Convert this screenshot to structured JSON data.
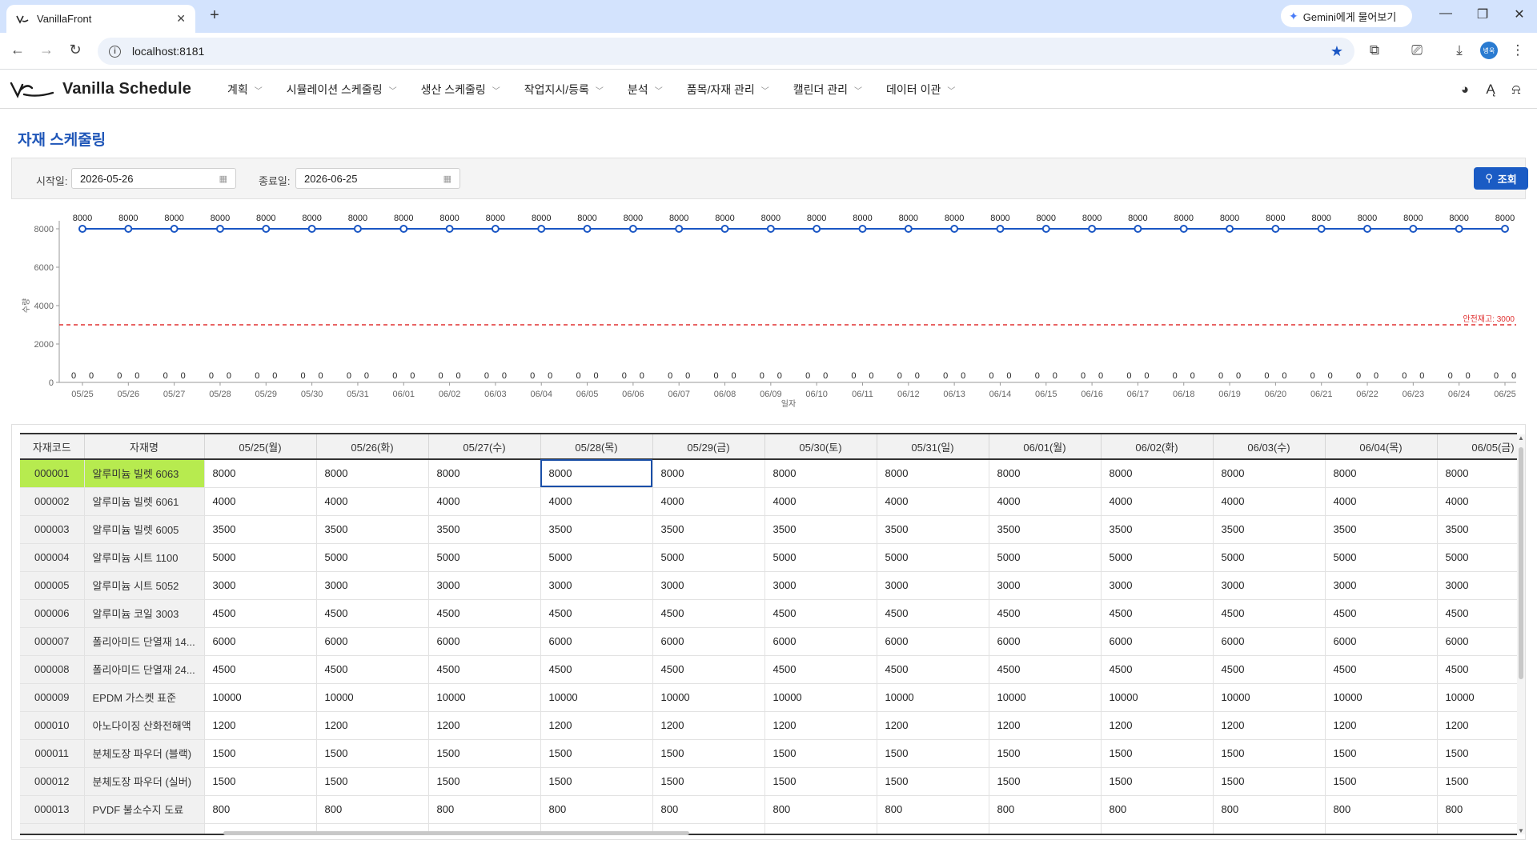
{
  "browser": {
    "tab_title": "VanillaFront",
    "gemini_label": "Gemini에게 물어보기",
    "url": "localhost:8181",
    "profile_initials": "병욱"
  },
  "app": {
    "name": "Vanilla Schedule",
    "menu": [
      {
        "label": "계획"
      },
      {
        "label": "시뮬레이션 스케줄링"
      },
      {
        "label": "생산 스케줄링"
      },
      {
        "label": "작업지시/등록"
      },
      {
        "label": "분석"
      },
      {
        "label": "품목/자재 관리"
      },
      {
        "label": "캘린더 관리"
      },
      {
        "label": "데이터 이관"
      }
    ]
  },
  "page": {
    "title": "자재 스케줄링",
    "search": {
      "start_label": "시작일:",
      "start_value": "2026-05-26",
      "end_label": "종료일:",
      "end_value": "2026-06-25",
      "button_label": "조회"
    }
  },
  "chart_data": {
    "type": "line",
    "x": [
      "05/25",
      "05/26",
      "05/27",
      "05/28",
      "05/29",
      "05/30",
      "05/31",
      "06/01",
      "06/02",
      "06/03",
      "06/04",
      "06/05",
      "06/06",
      "06/07",
      "06/08",
      "06/09",
      "06/10",
      "06/11",
      "06/12",
      "06/13",
      "06/14",
      "06/15",
      "06/16",
      "06/17",
      "06/18",
      "06/19",
      "06/20",
      "06/21",
      "06/22",
      "06/23",
      "06/24",
      "06/25"
    ],
    "series": [
      {
        "values": [
          8000,
          8000,
          8000,
          8000,
          8000,
          8000,
          8000,
          8000,
          8000,
          8000,
          8000,
          8000,
          8000,
          8000,
          8000,
          8000,
          8000,
          8000,
          8000,
          8000,
          8000,
          8000,
          8000,
          8000,
          8000,
          8000,
          8000,
          8000,
          8000,
          8000,
          8000,
          8000
        ]
      },
      {
        "values": [
          0,
          0,
          0,
          0,
          0,
          0,
          0,
          0,
          0,
          0,
          0,
          0,
          0,
          0,
          0,
          0,
          0,
          0,
          0,
          0,
          0,
          0,
          0,
          0,
          0,
          0,
          0,
          0,
          0,
          0,
          0,
          0
        ]
      },
      {
        "values": [
          0,
          0,
          0,
          0,
          0,
          0,
          0,
          0,
          0,
          0,
          0,
          0,
          0,
          0,
          0,
          0,
          0,
          0,
          0,
          0,
          0,
          0,
          0,
          0,
          0,
          0,
          0,
          0,
          0,
          0,
          0,
          0
        ]
      }
    ],
    "safety_stock": 3000,
    "safety_label": "안전재고: 3000",
    "xlabel": "일자",
    "ylabel": "수량",
    "ylim": [
      0,
      8000
    ],
    "yticks": [
      0,
      2000,
      4000,
      6000,
      8000
    ],
    "colors": {
      "line": "#1a56c4",
      "safety": "#e03131"
    }
  },
  "grid": {
    "columns": [
      "자재코드",
      "자재명",
      "05/25(월)",
      "05/26(화)",
      "05/27(수)",
      "05/28(목)",
      "05/29(금)",
      "05/30(토)",
      "05/31(일)",
      "06/01(월)",
      "06/02(화)",
      "06/03(수)",
      "06/04(목)",
      "06/05(금)"
    ],
    "rows": [
      {
        "code": "000001",
        "name": "알루미늄 빌렛 6063",
        "values": [
          "8000",
          "8000",
          "8000",
          "8000",
          "8000",
          "8000",
          "8000",
          "8000",
          "8000",
          "8000",
          "8000",
          "8000"
        ]
      },
      {
        "code": "000002",
        "name": "알루미늄 빌렛 6061",
        "values": [
          "4000",
          "4000",
          "4000",
          "4000",
          "4000",
          "4000",
          "4000",
          "4000",
          "4000",
          "4000",
          "4000",
          "4000"
        ]
      },
      {
        "code": "000003",
        "name": "알루미늄 빌렛 6005",
        "values": [
          "3500",
          "3500",
          "3500",
          "3500",
          "3500",
          "3500",
          "3500",
          "3500",
          "3500",
          "3500",
          "3500",
          "3500"
        ]
      },
      {
        "code": "000004",
        "name": "알루미늄 시트 1100",
        "values": [
          "5000",
          "5000",
          "5000",
          "5000",
          "5000",
          "5000",
          "5000",
          "5000",
          "5000",
          "5000",
          "5000",
          "5000"
        ]
      },
      {
        "code": "000005",
        "name": "알루미늄 시트 5052",
        "values": [
          "3000",
          "3000",
          "3000",
          "3000",
          "3000",
          "3000",
          "3000",
          "3000",
          "3000",
          "3000",
          "3000",
          "3000"
        ]
      },
      {
        "code": "000006",
        "name": "알루미늄 코일 3003",
        "values": [
          "4500",
          "4500",
          "4500",
          "4500",
          "4500",
          "4500",
          "4500",
          "4500",
          "4500",
          "4500",
          "4500",
          "4500"
        ]
      },
      {
        "code": "000007",
        "name": "폴리아미드 단열재 14...",
        "values": [
          "6000",
          "6000",
          "6000",
          "6000",
          "6000",
          "6000",
          "6000",
          "6000",
          "6000",
          "6000",
          "6000",
          "6000"
        ]
      },
      {
        "code": "000008",
        "name": "폴리아미드 단열재 24...",
        "values": [
          "4500",
          "4500",
          "4500",
          "4500",
          "4500",
          "4500",
          "4500",
          "4500",
          "4500",
          "4500",
          "4500",
          "4500"
        ]
      },
      {
        "code": "000009",
        "name": "EPDM 가스켓 표준",
        "values": [
          "10000",
          "10000",
          "10000",
          "10000",
          "10000",
          "10000",
          "10000",
          "10000",
          "10000",
          "10000",
          "10000",
          "10000"
        ]
      },
      {
        "code": "000010",
        "name": "아노다이징 산화전해액",
        "values": [
          "1200",
          "1200",
          "1200",
          "1200",
          "1200",
          "1200",
          "1200",
          "1200",
          "1200",
          "1200",
          "1200",
          "1200"
        ]
      },
      {
        "code": "000011",
        "name": "분체도장 파우더 (블랙)",
        "values": [
          "1500",
          "1500",
          "1500",
          "1500",
          "1500",
          "1500",
          "1500",
          "1500",
          "1500",
          "1500",
          "1500",
          "1500"
        ]
      },
      {
        "code": "000012",
        "name": "분체도장 파우더 (실버)",
        "values": [
          "1500",
          "1500",
          "1500",
          "1500",
          "1500",
          "1500",
          "1500",
          "1500",
          "1500",
          "1500",
          "1500",
          "1500"
        ]
      },
      {
        "code": "000013",
        "name": "PVDF 불소수지 도료",
        "values": [
          "800",
          "800",
          "800",
          "800",
          "800",
          "800",
          "800",
          "800",
          "800",
          "800",
          "800",
          "800"
        ]
      },
      {
        "code": "",
        "name": "",
        "values": [
          "",
          "",
          "",
          "",
          "",
          "",
          "",
          "",
          "",
          "",
          "",
          ""
        ]
      }
    ],
    "selected_row": 0,
    "focused_cell": [
      0,
      3
    ]
  }
}
